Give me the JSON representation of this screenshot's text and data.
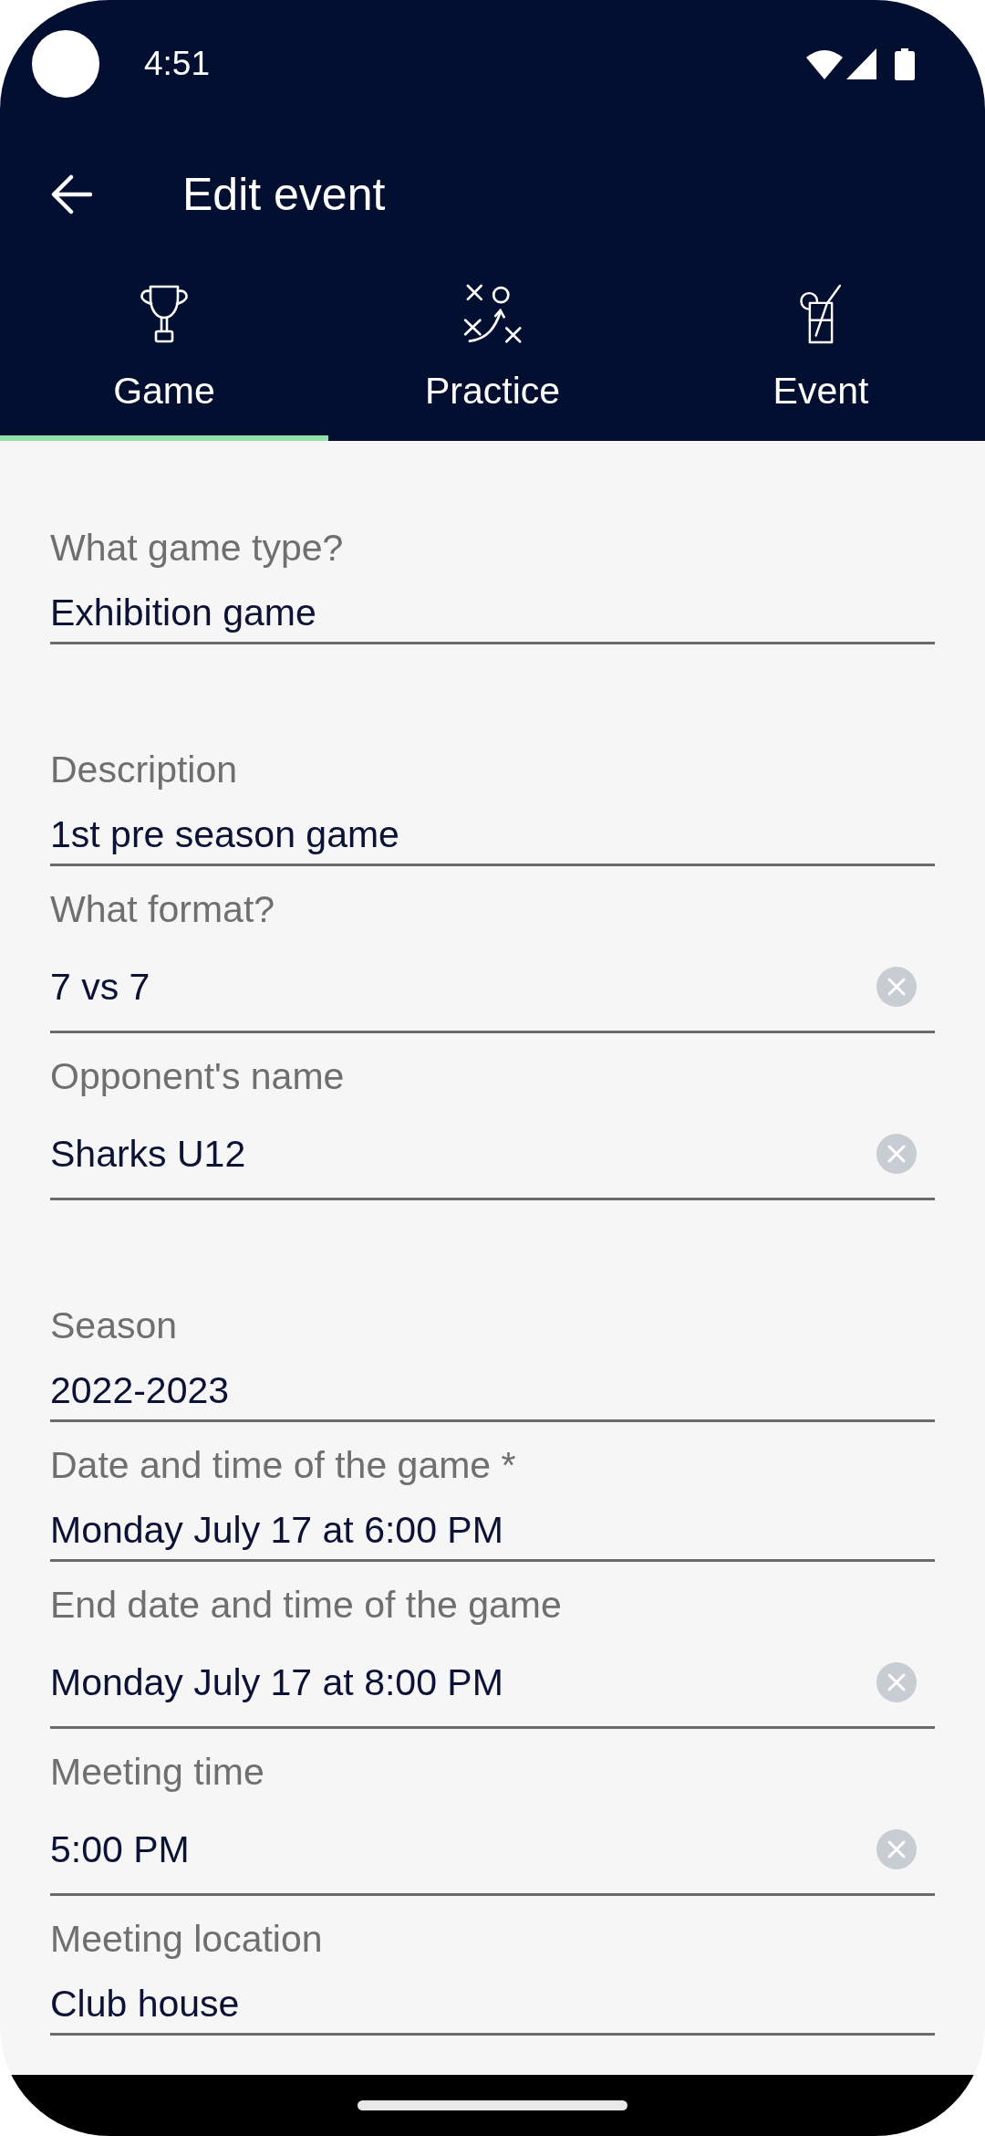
{
  "status_bar": {
    "time": "4:51"
  },
  "app_bar": {
    "title": "Edit event"
  },
  "tabs": [
    {
      "label": "Game",
      "selected": true
    },
    {
      "label": "Practice",
      "selected": false
    },
    {
      "label": "Event",
      "selected": false
    }
  ],
  "sections": [
    {
      "fields": [
        {
          "label": "What game type?",
          "value": "Exhibition game",
          "clearable": false
        }
      ]
    },
    {
      "fields": [
        {
          "label": "Description",
          "value": "1st pre season game",
          "clearable": false
        },
        {
          "label": "What format?",
          "value": "7 vs 7",
          "clearable": true
        },
        {
          "label": "Opponent's name",
          "value": "Sharks U12",
          "clearable": true
        }
      ]
    },
    {
      "fields": [
        {
          "label": "Season",
          "value": "2022-2023",
          "clearable": false
        },
        {
          "label": "Date and time of the game *",
          "value": "Monday July 17 at 6:00 PM",
          "clearable": false
        },
        {
          "label": "End date and time of the game",
          "value": "Monday July 17 at 8:00 PM",
          "clearable": true
        },
        {
          "label": "Meeting time",
          "value": "5:00 PM",
          "clearable": true
        },
        {
          "label": "Meeting location",
          "value": "Club house",
          "clearable": false
        }
      ]
    }
  ]
}
